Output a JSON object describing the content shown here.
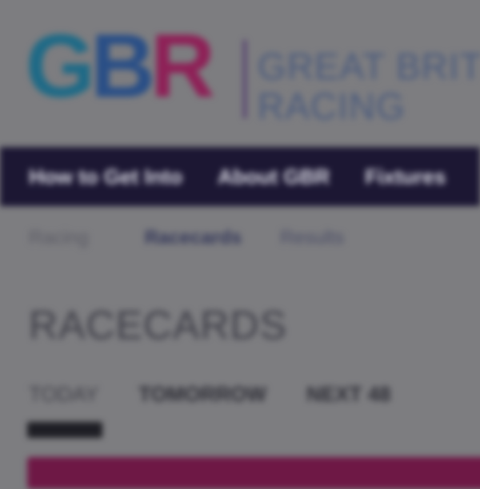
{
  "logo": {
    "mark_g": "G",
    "mark_b": "B",
    "mark_r": "R",
    "line1": "GREAT BRIT",
    "line2": "RACING",
    "colors": {
      "g": "#1f6a86",
      "b": "#2a4f86",
      "r": "#8e2157"
    }
  },
  "nav": {
    "items": [
      {
        "label": "How to Get Into"
      },
      {
        "label": "About GBR"
      },
      {
        "label": "Fixtures"
      }
    ]
  },
  "subnav": {
    "items": [
      {
        "label": "Racing"
      },
      {
        "label": "Racecards"
      },
      {
        "label": "Results"
      }
    ]
  },
  "page": {
    "title": "RACECARDS"
  },
  "tabs": {
    "items": [
      {
        "label": "TODAY",
        "active": true
      },
      {
        "label": "TOMORROW",
        "active": false
      },
      {
        "label": "NEXT 48",
        "active": false
      }
    ]
  },
  "theme": {
    "nav_bg": "#1c1733",
    "banner": "#6e1845",
    "background": "#7d7d80"
  }
}
